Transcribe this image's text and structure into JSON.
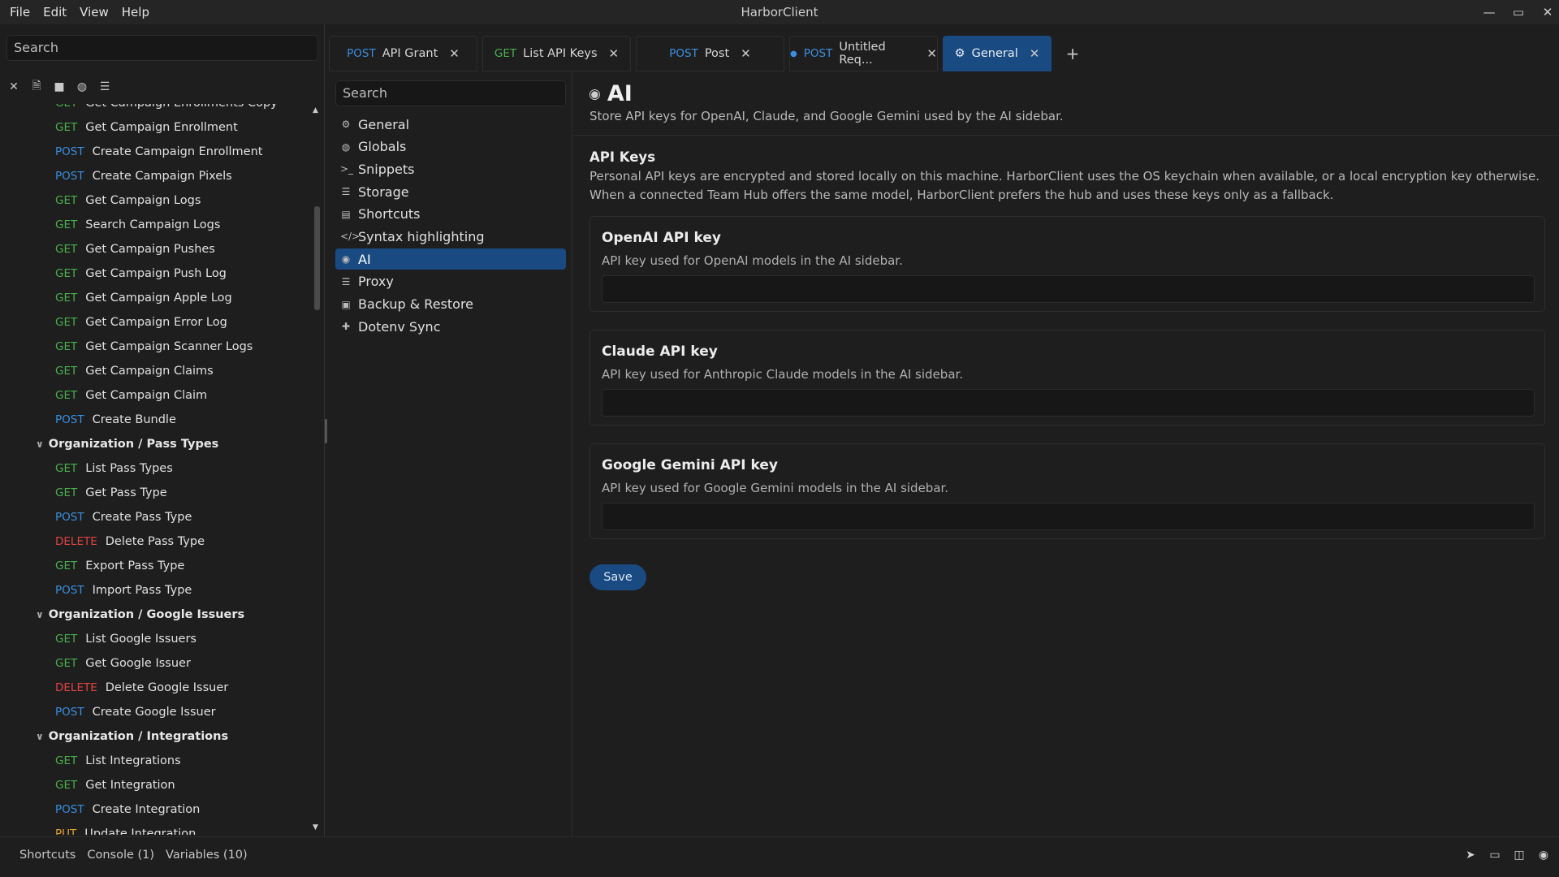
{
  "window": {
    "title": "HarborClient",
    "menu": [
      "File",
      "Edit",
      "View",
      "Help"
    ],
    "controls": [
      "—",
      "▭",
      "✕"
    ]
  },
  "sidebar": {
    "search_placeholder": "Search",
    "tool_icons": [
      "close-icon",
      "file-icon",
      "folder-icon",
      "globe-icon",
      "database-icon"
    ],
    "tree": [
      {
        "kind": "req",
        "method": "GET",
        "name": "Get Campaign Enrollments Copy"
      },
      {
        "kind": "req",
        "method": "GET",
        "name": "Get Campaign Enrollment"
      },
      {
        "kind": "req",
        "method": "POST",
        "name": "Create Campaign Enrollment"
      },
      {
        "kind": "req",
        "method": "POST",
        "name": "Create Campaign Pixels"
      },
      {
        "kind": "req",
        "method": "GET",
        "name": "Get Campaign Logs"
      },
      {
        "kind": "req",
        "method": "GET",
        "name": "Search Campaign Logs"
      },
      {
        "kind": "req",
        "method": "GET",
        "name": "Get Campaign Pushes"
      },
      {
        "kind": "req",
        "method": "GET",
        "name": "Get Campaign Push Log"
      },
      {
        "kind": "req",
        "method": "GET",
        "name": "Get Campaign Apple Log"
      },
      {
        "kind": "req",
        "method": "GET",
        "name": "Get Campaign Error Log"
      },
      {
        "kind": "req",
        "method": "GET",
        "name": "Get Campaign Scanner Logs"
      },
      {
        "kind": "req",
        "method": "GET",
        "name": "Get Campaign Claims"
      },
      {
        "kind": "req",
        "method": "GET",
        "name": "Get Campaign Claim"
      },
      {
        "kind": "req",
        "method": "POST",
        "name": "Create Bundle"
      },
      {
        "kind": "folder",
        "name": "Organization / Pass Types"
      },
      {
        "kind": "req",
        "method": "GET",
        "name": "List Pass Types"
      },
      {
        "kind": "req",
        "method": "GET",
        "name": "Get Pass Type"
      },
      {
        "kind": "req",
        "method": "POST",
        "name": "Create Pass Type"
      },
      {
        "kind": "req",
        "method": "DELETE",
        "name": "Delete Pass Type"
      },
      {
        "kind": "req",
        "method": "GET",
        "name": "Export Pass Type"
      },
      {
        "kind": "req",
        "method": "POST",
        "name": "Import Pass Type"
      },
      {
        "kind": "folder",
        "name": "Organization / Google Issuers"
      },
      {
        "kind": "req",
        "method": "GET",
        "name": "List Google Issuers"
      },
      {
        "kind": "req",
        "method": "GET",
        "name": "Get Google Issuer"
      },
      {
        "kind": "req",
        "method": "DELETE",
        "name": "Delete Google Issuer"
      },
      {
        "kind": "req",
        "method": "POST",
        "name": "Create Google Issuer"
      },
      {
        "kind": "folder",
        "name": "Organization / Integrations"
      },
      {
        "kind": "req",
        "method": "GET",
        "name": "List Integrations"
      },
      {
        "kind": "req",
        "method": "GET",
        "name": "Get Integration"
      },
      {
        "kind": "req",
        "method": "POST",
        "name": "Create Integration"
      },
      {
        "kind": "req",
        "method": "PUT",
        "name": "Update Integration"
      }
    ]
  },
  "tabs": [
    {
      "method": "POST",
      "label": "API Grant",
      "dirty": false,
      "active": false
    },
    {
      "method": "GET",
      "label": "List API Keys",
      "dirty": false,
      "active": false
    },
    {
      "method": "POST",
      "label": "Post",
      "dirty": false,
      "active": false
    },
    {
      "method": "POST",
      "label": "Untitled Req...",
      "dirty": true,
      "active": false
    },
    {
      "method": "",
      "label": "General",
      "dirty": false,
      "active": true,
      "icon": "gear-icon"
    }
  ],
  "tab_add_label": "+",
  "tab_close_label": "✕",
  "settings": {
    "search_placeholder": "Search",
    "nav": [
      {
        "label": "General",
        "icon": "gear-icon",
        "glyph": "⚙"
      },
      {
        "label": "Globals",
        "icon": "globe-icon",
        "glyph": "◍"
      },
      {
        "label": "Snippets",
        "icon": "terminal-icon",
        "glyph": ">_"
      },
      {
        "label": "Storage",
        "icon": "database-icon",
        "glyph": "☰"
      },
      {
        "label": "Shortcuts",
        "icon": "keyboard-icon",
        "glyph": "▤"
      },
      {
        "label": "Syntax highlighting",
        "icon": "code-icon",
        "glyph": "</>"
      },
      {
        "label": "AI",
        "icon": "robot-icon",
        "glyph": "◉",
        "active": true
      },
      {
        "label": "Proxy",
        "icon": "server-icon",
        "glyph": "☰"
      },
      {
        "label": "Backup & Restore",
        "icon": "save-icon",
        "glyph": "▣"
      },
      {
        "label": "Dotenv Sync",
        "icon": "puzzle-icon",
        "glyph": "✚"
      }
    ]
  },
  "content": {
    "title": "AI",
    "title_icon": "robot-icon",
    "subtitle": "Store API keys for OpenAI, Claude, and Google Gemini used by the AI sidebar.",
    "section_title": "API Keys",
    "section_desc": "Personal API keys are encrypted and stored locally on this machine. HarborClient uses the OS keychain when available, or a local encryption key otherwise. When a connected Team Hub offers the same model, HarborClient prefers the hub and uses these keys only as a fallback.",
    "keys": [
      {
        "title": "OpenAI API key",
        "desc": "API key used for OpenAI models in the AI sidebar.",
        "value": ""
      },
      {
        "title": "Claude API key",
        "desc": "API key used for Anthropic Claude models in the AI sidebar.",
        "value": ""
      },
      {
        "title": "Google Gemini API key",
        "desc": "API key used for Google Gemini models in the AI sidebar.",
        "value": ""
      }
    ],
    "save_label": "Save"
  },
  "statusbar": {
    "items": [
      "Shortcuts",
      "Console (1)",
      "Variables (10)"
    ],
    "right_icons": [
      "send-icon",
      "inbox-icon",
      "layout-icon",
      "robot-icon"
    ]
  }
}
